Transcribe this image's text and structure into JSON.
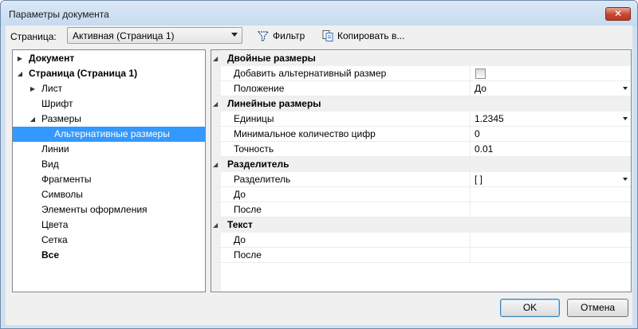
{
  "window": {
    "title": "Параметры документа",
    "close_symbol": "✕"
  },
  "toolbar": {
    "page_label": "Страница:",
    "page_select_value": "Активная (Страница 1)",
    "filter_label": "Фильтр",
    "copy_label": "Копировать в..."
  },
  "tree": {
    "items": [
      {
        "label": "Документ",
        "bold": true,
        "arrow": "▶"
      },
      {
        "label": "Страница (Страница 1)",
        "bold": true,
        "arrow": "◢"
      },
      {
        "label": "Лист",
        "bold": false,
        "arrow": "▶"
      },
      {
        "label": "Шрифт",
        "bold": false,
        "arrow": ""
      },
      {
        "label": "Размеры",
        "bold": false,
        "arrow": "◢"
      },
      {
        "label": "Альтернативные размеры",
        "bold": false,
        "arrow": "",
        "selected": true
      },
      {
        "label": "Линии",
        "bold": false,
        "arrow": ""
      },
      {
        "label": "Вид",
        "bold": false,
        "arrow": ""
      },
      {
        "label": "Фрагменты",
        "bold": false,
        "arrow": ""
      },
      {
        "label": "Символы",
        "bold": false,
        "arrow": ""
      },
      {
        "label": "Элементы оформления",
        "bold": false,
        "arrow": ""
      },
      {
        "label": "Цвета",
        "bold": false,
        "arrow": ""
      },
      {
        "label": "Сетка",
        "bold": false,
        "arrow": ""
      },
      {
        "label": "Все",
        "bold": true,
        "arrow": ""
      }
    ]
  },
  "properties": {
    "collapse_symbol": "◢",
    "categories": [
      {
        "title": "Двойные размеры",
        "rows": [
          {
            "name": "Добавить альтернативный размер",
            "value": "",
            "checkbox": true,
            "checked": false
          },
          {
            "name": "Положение",
            "value": "До",
            "dropdown": true
          }
        ]
      },
      {
        "title": "Линейные размеры",
        "rows": [
          {
            "name": "Единицы",
            "value": "1.2345",
            "dropdown": true
          },
          {
            "name": "Минимальное количество цифр",
            "value": "0"
          },
          {
            "name": "Точность",
            "value": "0.01"
          }
        ]
      },
      {
        "title": "Разделитель",
        "rows": [
          {
            "name": "Разделитель",
            "value": "[ ]",
            "dropdown": true
          },
          {
            "name": "До",
            "value": ""
          },
          {
            "name": "После",
            "value": ""
          }
        ]
      },
      {
        "title": "Текст",
        "rows": [
          {
            "name": "До",
            "value": ""
          },
          {
            "name": "После",
            "value": ""
          }
        ]
      }
    ]
  },
  "buttons": {
    "ok": "OK",
    "cancel": "Отмена"
  }
}
